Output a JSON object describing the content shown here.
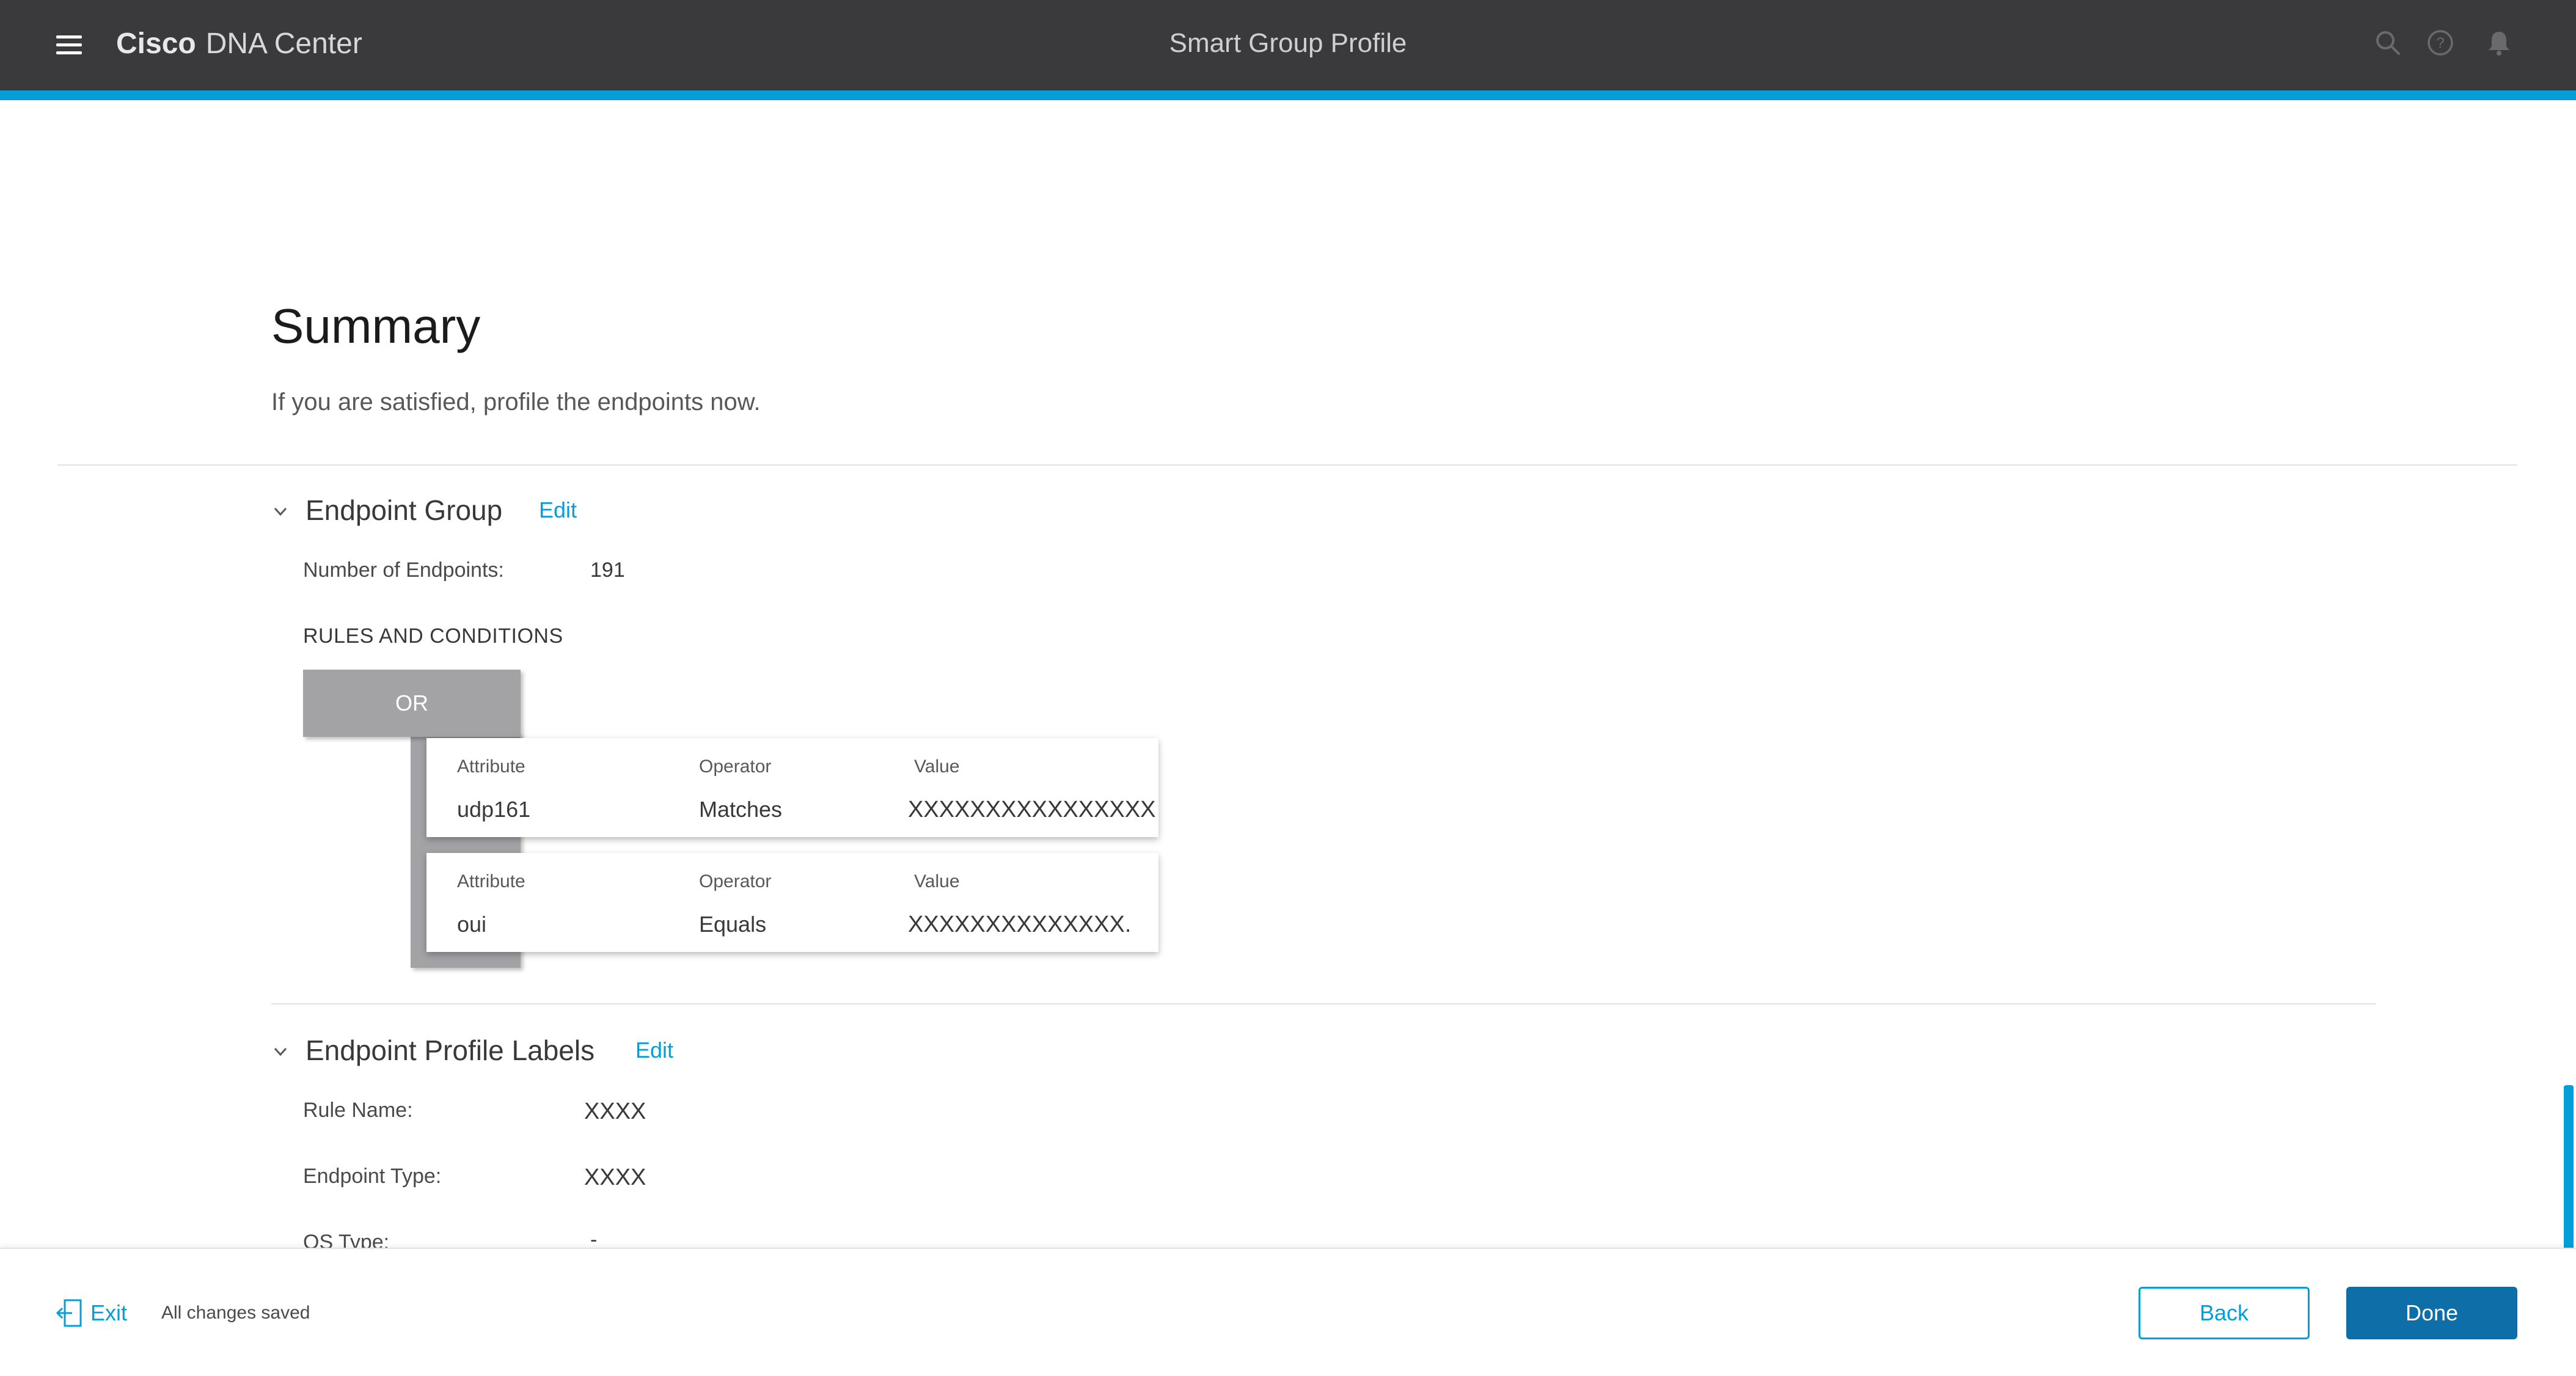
{
  "header": {
    "brand_bold": "Cisco",
    "brand_light": "DNA Center",
    "title": "Smart Group Profile",
    "icons": [
      "search-icon",
      "help-icon",
      "bell-icon"
    ]
  },
  "summary": {
    "title": "Summary",
    "subtitle": "If you are satisfied, profile the endpoints now."
  },
  "endpoint_group": {
    "title": "Endpoint Group",
    "edit_label": "Edit",
    "num_endpoints_label": "Number of Endpoints:",
    "num_endpoints_value": "191",
    "rules_heading": "RULES AND CONDITIONS",
    "operator": "OR",
    "rules": [
      {
        "attribute_header": "Attribute",
        "operator_header": "Operator",
        "value_header": "Value",
        "attribute": "udp161",
        "operator": "Matches",
        "value": "XXXXXXXXXXXXXXXX"
      },
      {
        "attribute_header": "Attribute",
        "operator_header": "Operator",
        "value_header": "Value",
        "attribute": "oui",
        "operator": "Equals",
        "value": "XXXXXXXXXXXXXX."
      }
    ]
  },
  "endpoint_profile_labels": {
    "title": "Endpoint Profile Labels",
    "edit_label": "Edit",
    "rule_name_label": "Rule Name:",
    "rule_name_value": "XXXX",
    "endpoint_type_label": "Endpoint Type:",
    "endpoint_type_value": "XXXX",
    "os_type_label": "OS Type:",
    "os_type_value": "-"
  },
  "footer": {
    "exit_label": "Exit",
    "saved_status": "All changes saved",
    "back_label": "Back",
    "done_label": "Done"
  },
  "colors": {
    "topbar": "#3a3a3c",
    "accent": "#049fd9",
    "primary_button": "#0d6ea8"
  }
}
